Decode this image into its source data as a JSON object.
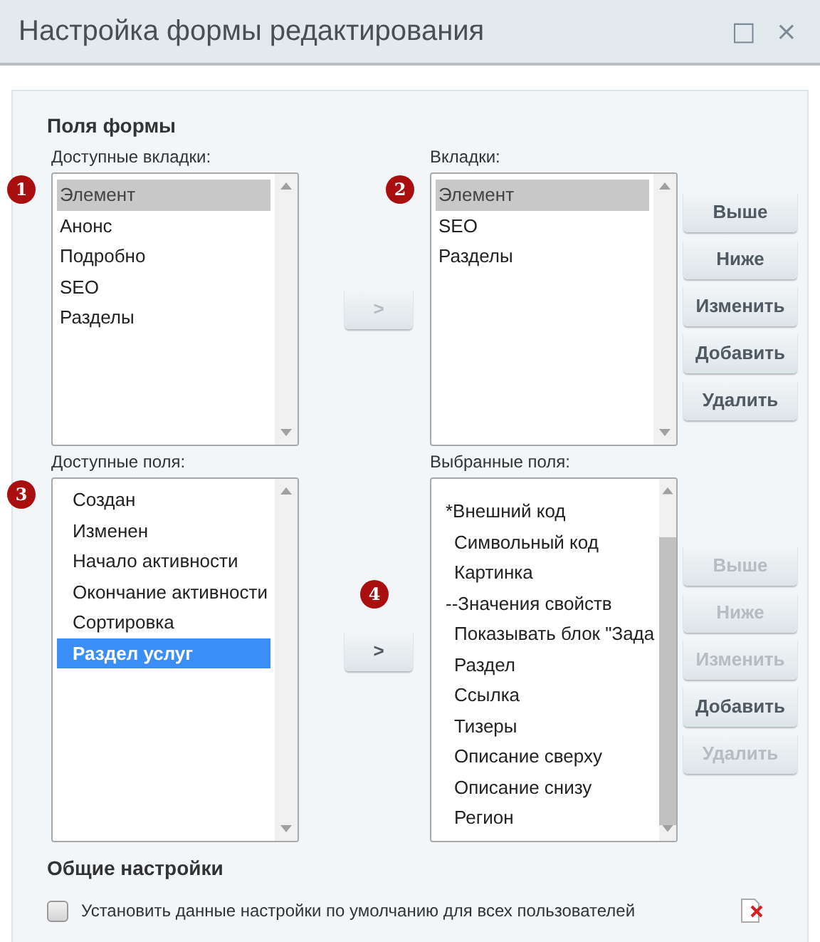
{
  "window": {
    "title": "Настройка формы редактирования",
    "buttons": [
      "□",
      "×"
    ]
  },
  "section_title": "Поля формы",
  "tabs_block": {
    "available": {
      "label": "Доступные вкладки:",
      "badge": "1",
      "focused": false,
      "items": [
        {
          "text": "Элемент",
          "selected": true
        },
        {
          "text": "Анонс",
          "selected": false
        },
        {
          "text": "Подробно",
          "selected": false
        },
        {
          "text": "SEO",
          "selected": false
        },
        {
          "text": "Разделы",
          "selected": false
        }
      ]
    },
    "move": {
      "text": ">",
      "disabled": true
    },
    "chosen": {
      "label": "Вкладки:",
      "badge": "2",
      "focused": false,
      "items": [
        {
          "text": "Элемент",
          "selected": true
        },
        {
          "text": "SEO",
          "selected": false
        },
        {
          "text": "Разделы",
          "selected": false
        }
      ]
    },
    "buttons": [
      {
        "text": "Выше",
        "disabled": false
      },
      {
        "text": "Ниже",
        "disabled": false
      },
      {
        "text": "Изменить",
        "disabled": false
      },
      {
        "text": "Добавить",
        "disabled": false
      },
      {
        "text": "Удалить",
        "disabled": false
      }
    ]
  },
  "fields_block": {
    "available": {
      "label": "Доступные поля:",
      "badge": "3",
      "focused": true,
      "items": [
        {
          "text": "Создан",
          "selected": false
        },
        {
          "text": "Изменен",
          "selected": false
        },
        {
          "text": "Начало активности",
          "selected": false
        },
        {
          "text": "Окончание активности",
          "selected": false
        },
        {
          "text": "Сортировка",
          "selected": false
        },
        {
          "text": "Раздел услуг",
          "selected": true
        }
      ]
    },
    "move": {
      "text": ">",
      "disabled": false,
      "badge": "4"
    },
    "chosen": {
      "label": "Выбранные поля:",
      "items": [
        {
          "text": "*Внешний код",
          "kind": "section",
          "selected": false
        },
        {
          "text": "Символьный код",
          "kind": "field",
          "selected": false
        },
        {
          "text": "Картинка",
          "kind": "field",
          "selected": false
        },
        {
          "text": "--Значения свойств",
          "kind": "section",
          "selected": false
        },
        {
          "text": "Показывать блок \"Зада",
          "kind": "field",
          "selected": false
        },
        {
          "text": "Раздел",
          "kind": "field",
          "selected": false
        },
        {
          "text": "Ссылка",
          "kind": "field",
          "selected": false
        },
        {
          "text": "Тизеры",
          "kind": "field",
          "selected": false
        },
        {
          "text": "Описание сверху",
          "kind": "field",
          "selected": false
        },
        {
          "text": "Описание снизу",
          "kind": "field",
          "selected": false
        },
        {
          "text": "Регион",
          "kind": "field",
          "selected": false
        }
      ]
    },
    "buttons": [
      {
        "text": "Выше",
        "disabled": true
      },
      {
        "text": "Ниже",
        "disabled": true
      },
      {
        "text": "Изменить",
        "disabled": true
      },
      {
        "text": "Добавить",
        "disabled": false
      },
      {
        "text": "Удалить",
        "disabled": true
      }
    ]
  },
  "general": {
    "title": "Общие настройки",
    "checkbox": {
      "label": "Установить данные настройки по умолчанию для всех пользователей",
      "checked": false
    }
  }
}
